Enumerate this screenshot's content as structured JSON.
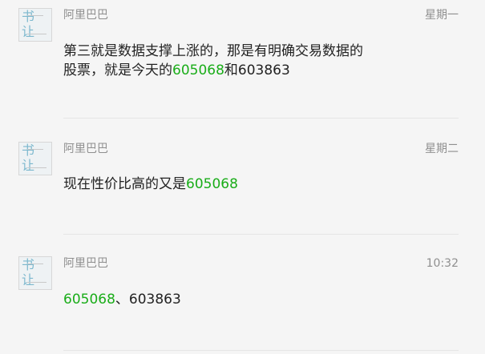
{
  "messages": [
    {
      "sender": "阿里巴巴",
      "time": "星期一",
      "line1": "第三就是数据支撑上涨的，那是有明确交易数据的",
      "line2_prefix": "股票，就是今天的",
      "stock_a": "605068",
      "middle": "和",
      "stock_b": "603863"
    },
    {
      "sender": "阿里巴巴",
      "time": "星期二",
      "prefix": "现在性价比高的又是",
      "stock": "605068"
    },
    {
      "sender": "阿里巴巴",
      "time": "10:32",
      "stock_a": "605068",
      "separator": "、",
      "stock_b": "603863"
    }
  ],
  "colors": {
    "background": "#f5f5f5",
    "stock_code": "#1aad19",
    "meta_text": "#8f8f8f",
    "body_text": "#222222"
  }
}
